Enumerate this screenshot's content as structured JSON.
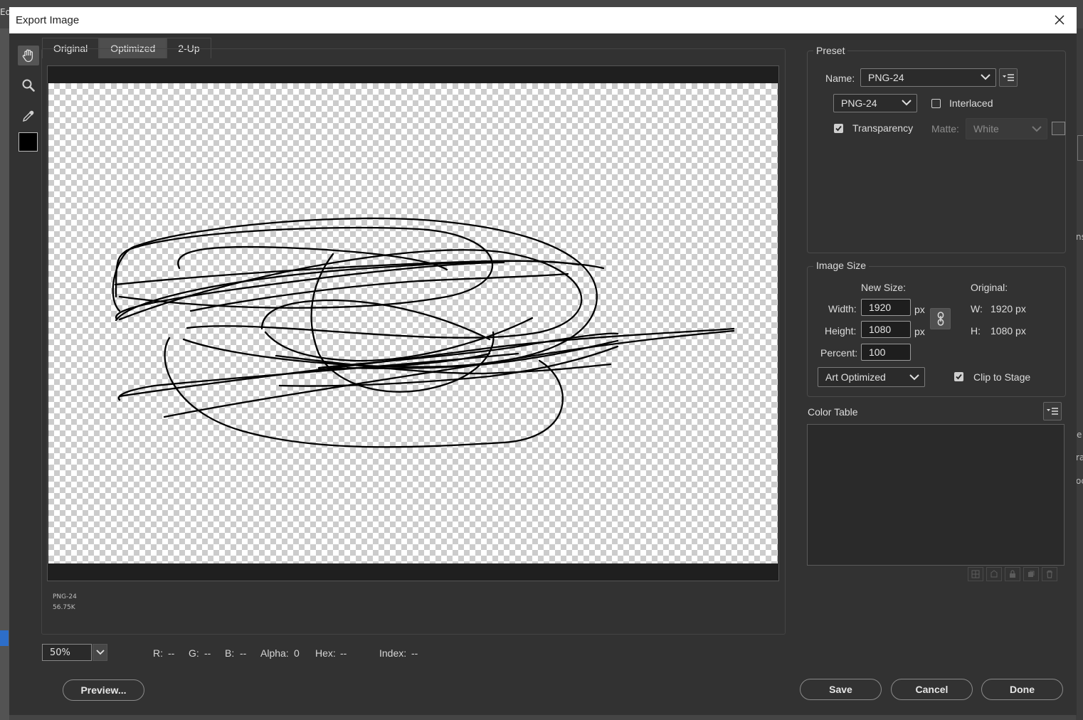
{
  "dialog": {
    "title": "Export Image"
  },
  "background_app": {
    "title_fragment": "Ed",
    "right_fragments": [
      "ns",
      "e",
      "ra",
      "oc"
    ]
  },
  "tabs": [
    {
      "label": "Original",
      "active": false
    },
    {
      "label": "Optimized",
      "active": true
    },
    {
      "label": "2-Up",
      "active": false
    }
  ],
  "tools": [
    "hand-icon",
    "zoom-icon",
    "eyedropper-icon",
    "color-swatch"
  ],
  "preview": {
    "format": "PNG-24",
    "size": "56.75K"
  },
  "zoom": {
    "value": "50%"
  },
  "readout": {
    "r_label": "R:",
    "r": "--",
    "g_label": "G:",
    "g": "--",
    "b_label": "B:",
    "b": "--",
    "alpha_label": "Alpha:",
    "alpha": "0",
    "hex_label": "Hex:",
    "hex": "--",
    "index_label": "Index:",
    "index": "--"
  },
  "preset": {
    "title": "Preset",
    "name_label": "Name:",
    "name_value": "PNG-24",
    "format_value": "PNG-24",
    "interlaced_label": "Interlaced",
    "interlaced_checked": false,
    "transparency_label": "Transparency",
    "transparency_checked": true,
    "matte_label": "Matte:",
    "matte_value": "White"
  },
  "image_size": {
    "title": "Image Size",
    "new_size_label": "New Size:",
    "original_label": "Original:",
    "width_label": "Width:",
    "width_value": "1920",
    "height_label": "Height:",
    "height_value": "1080",
    "px_unit": "px",
    "percent_label": "Percent:",
    "percent_value": "100",
    "orig_w_label": "W:",
    "orig_w_value": "1920 px",
    "orig_h_label": "H:",
    "orig_h_value": "1080 px",
    "quality_value": "Art Optimized",
    "clip_label": "Clip to Stage",
    "clip_checked": true
  },
  "color_table": {
    "title": "Color Table"
  },
  "buttons": {
    "preview": "Preview...",
    "save": "Save",
    "cancel": "Cancel",
    "done": "Done"
  }
}
